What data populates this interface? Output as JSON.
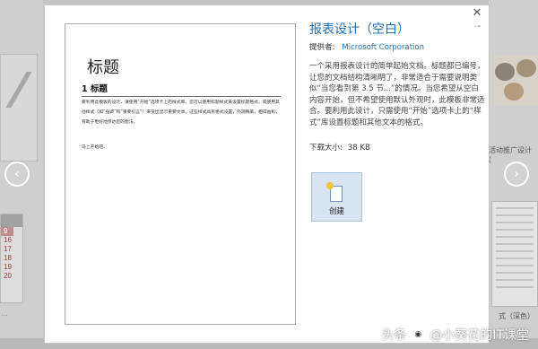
{
  "dialog": {
    "template_title": "报表设计（空白）",
    "provider_label": "提供者:",
    "provider_value": "Microsoft Corporation",
    "description": "一个采用报表设计的简单起始文档。标题都已编号，让您的文档结构清晰明了，非常适合于需要说明类似“当您看到第 3.5 节...”的情况。当您希望从空白内容开始，但不希望使用默认外观时，此模板非常适合。要利用此设计，只需使用“开始”选项卡上的“样式”库设置标题和其他文本的格式。",
    "size_label": "下载大小:",
    "size_value": "38 KB",
    "create_label": "创建",
    "close_icon": "✕",
    "pin_icon": "pin-icon"
  },
  "preview": {
    "title": "标题",
    "heading": "1  标题",
    "body": "要利用此模板的设计，请使用“开始”选项卡上的样式库。您可以使用标题样式来设置标题格式，或使用其他样式（如“强调”和“重要引言”）来突出显示重要文本。这些样式具有格式设置，外观精美，相得益彰，有助于更好地传达您的想法。",
    "body2": "马上开始吧。"
  },
  "background": {
    "right_label": "活动推广设计 (",
    "right_label2": "式（深色）",
    "left_dots": "...",
    "calendar_nums": [
      "9",
      "16",
      "17",
      "18",
      "19",
      "20"
    ]
  },
  "watermark": {
    "text": "头条 @小葵花的IT课堂",
    "prefix": "头条",
    "handle": "@小葵花的IT课堂"
  },
  "nav": {
    "prev_icon": "‹",
    "next_icon": "›"
  },
  "colors": {
    "accent": "#1f6fb5",
    "create_bg": "#d9e4f2"
  }
}
